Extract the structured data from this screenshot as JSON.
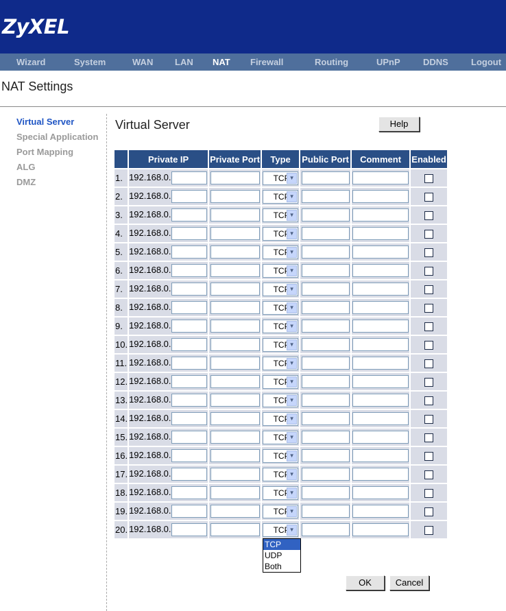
{
  "brand": {
    "logo": "ZyXEL"
  },
  "nav": [
    {
      "label": "Wizard"
    },
    {
      "label": "System"
    },
    {
      "label": "WAN"
    },
    {
      "label": "LAN"
    },
    {
      "label": "NAT",
      "active": true
    },
    {
      "label": "Firewall"
    },
    {
      "label": "Routing"
    },
    {
      "label": "UPnP"
    },
    {
      "label": "DDNS"
    },
    {
      "label": "Logout"
    }
  ],
  "page_title": "NAT Settings",
  "sidebar": [
    {
      "label": "Virtual Server",
      "active": true
    },
    {
      "label": "Special Application"
    },
    {
      "label": "Port Mapping"
    },
    {
      "label": "ALG"
    },
    {
      "label": "DMZ"
    }
  ],
  "section_title": "Virtual Server",
  "help_label": "Help",
  "table": {
    "headers": [
      "Private IP",
      "Private Port",
      "Type",
      "Public Port",
      "Comment",
      "Enabled"
    ],
    "ip_prefix": "192.168.0.",
    "rows": [
      {
        "num": "1.",
        "type": "TCP",
        "enabled": false
      },
      {
        "num": "2.",
        "type": "TCP",
        "enabled": false
      },
      {
        "num": "3.",
        "type": "TCP",
        "enabled": false
      },
      {
        "num": "4.",
        "type": "TCP",
        "enabled": false
      },
      {
        "num": "5.",
        "type": "TCP",
        "enabled": false
      },
      {
        "num": "6.",
        "type": "TCP",
        "enabled": false
      },
      {
        "num": "7.",
        "type": "TCP",
        "enabled": false
      },
      {
        "num": "8.",
        "type": "TCP",
        "enabled": false
      },
      {
        "num": "9.",
        "type": "TCP",
        "enabled": false
      },
      {
        "num": "10.",
        "type": "TCP",
        "enabled": false
      },
      {
        "num": "11.",
        "type": "TCP",
        "enabled": false
      },
      {
        "num": "12.",
        "type": "TCP",
        "enabled": false
      },
      {
        "num": "13.",
        "type": "TCP",
        "enabled": false
      },
      {
        "num": "14.",
        "type": "TCP",
        "enabled": false
      },
      {
        "num": "15.",
        "type": "TCP",
        "enabled": false
      },
      {
        "num": "16.",
        "type": "TCP",
        "enabled": false
      },
      {
        "num": "17.",
        "type": "TCP",
        "enabled": false
      },
      {
        "num": "18.",
        "type": "TCP",
        "enabled": false
      },
      {
        "num": "19.",
        "type": "TCP",
        "enabled": false
      },
      {
        "num": "20.",
        "type": "TCP",
        "enabled": false
      }
    ]
  },
  "dropdown_open": {
    "options": [
      "TCP",
      "UDP",
      "Both"
    ],
    "highlighted": "TCP"
  },
  "ok_label": "OK",
  "cancel_label": "Cancel",
  "colors": {
    "header_bg": "#0f2a8a",
    "nav_bg": "#4f6f9c",
    "table_header": "#2a4f86",
    "table_cell": "#d9dce6",
    "accent_link": "#1f55c4"
  }
}
